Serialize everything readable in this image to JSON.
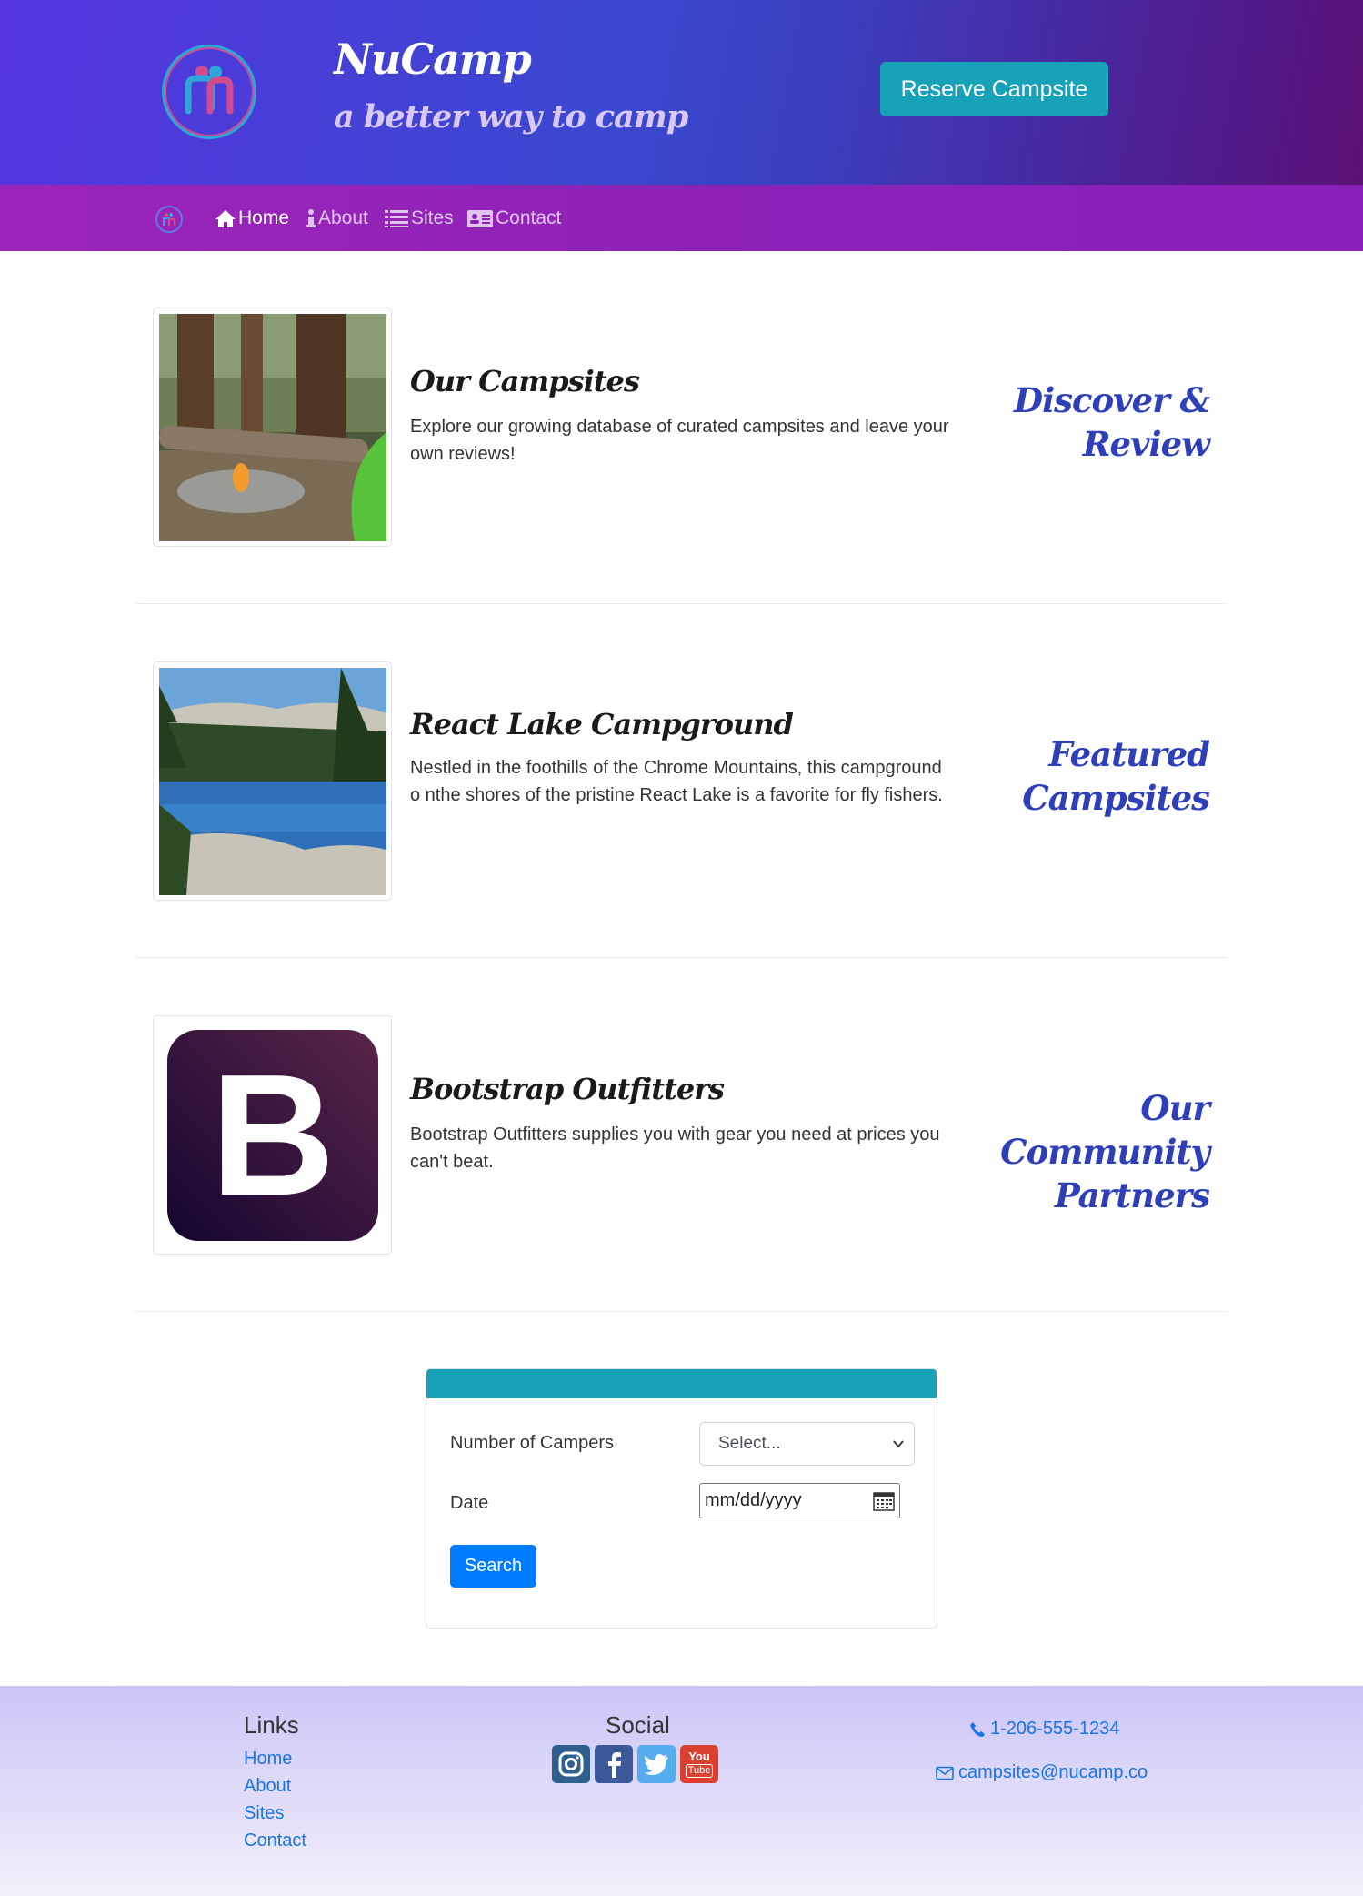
{
  "header": {
    "brand_title": "NuCamp",
    "brand_subtitle": "a better way to camp",
    "reserve_button": "Reserve Campsite"
  },
  "nav": {
    "items": [
      {
        "label": "Home",
        "icon": "home-icon",
        "active": true
      },
      {
        "label": "About",
        "icon": "info-icon",
        "active": false
      },
      {
        "label": "Sites",
        "icon": "list-icon",
        "active": false
      },
      {
        "label": "Contact",
        "icon": "address-card-icon",
        "active": false
      }
    ]
  },
  "sections": [
    {
      "title": "Our Campsites",
      "text": "Explore our growing database of curated campsites and leave your own reviews!",
      "side_heading": "Discover & Review",
      "image": "campfire-forest-image"
    },
    {
      "title": "React Lake Campground",
      "text": "Nestled in the foothills of the Chrome Mountains, this campground o nthe shores of the pristine React Lake is a favorite for fly fishers.",
      "side_heading": "Featured Campsites",
      "image": "mountain-lake-image"
    },
    {
      "title": "Bootstrap Outfitters",
      "text": "Bootstrap Outfitters supplies you with gear you need at prices you can't beat.",
      "side_heading": "Our Community Partners",
      "image": "bootstrap-logo-image",
      "logo_letter": "B"
    }
  ],
  "search_form": {
    "campers_label": "Number of Campers",
    "campers_value": "Select...",
    "date_label": "Date",
    "date_placeholder": "mm/dd/yyyy",
    "search_button": "Search"
  },
  "footer": {
    "links_heading": "Links",
    "links": [
      "Home",
      "About",
      "Sites",
      "Contact"
    ],
    "social_heading": "Social",
    "social_icons": [
      "instagram-icon",
      "facebook-icon",
      "twitter-icon",
      "youtube-icon"
    ],
    "youtube_label_top": "You",
    "youtube_label_bottom": "Tube",
    "phone": "1-206-555-1234",
    "email": "campsites@nucamp.co"
  },
  "colors": {
    "accent_teal": "#17a2b8",
    "side_heading_blue": "#2f3fb8",
    "link_blue": "#1a73e8",
    "primary_button": "#007bff"
  }
}
